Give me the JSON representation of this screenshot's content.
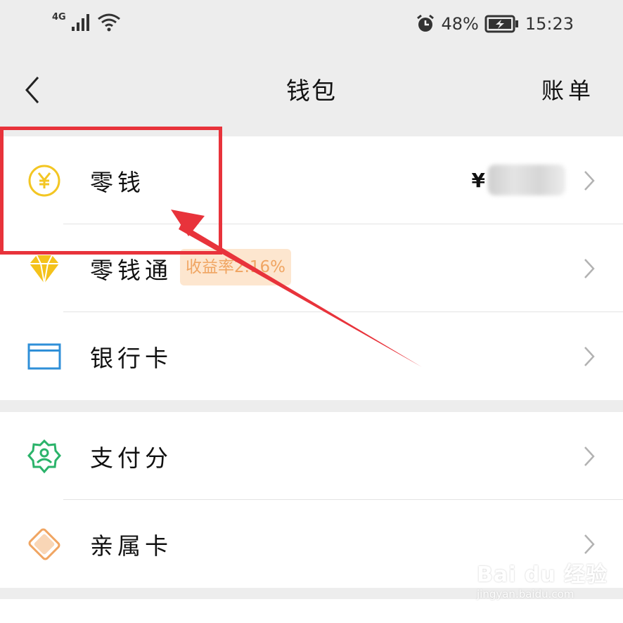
{
  "status": {
    "network": "4G",
    "battery": "48%",
    "time": "15:23"
  },
  "nav": {
    "title": "钱包",
    "right_action": "账单"
  },
  "groups": [
    {
      "rows": [
        {
          "label": "零钱",
          "icon": "yen-coin-icon",
          "value_prefix": "¥"
        },
        {
          "label": "零钱通",
          "icon": "diamond-icon",
          "badge": "收益率2.16%"
        },
        {
          "label": "银行卡",
          "icon": "bank-card-icon"
        }
      ]
    },
    {
      "rows": [
        {
          "label": "支付分",
          "icon": "pay-score-icon"
        },
        {
          "label": "亲属卡",
          "icon": "family-card-icon"
        }
      ]
    }
  ],
  "watermark": {
    "brand": "Bai du 经验",
    "url": "jingyan.baidu.com"
  },
  "colors": {
    "highlight": "#e8333b",
    "yen_icon": "#f3c623",
    "diamond_icon": "#f4c21b",
    "bank_card_icon": "#2f8fd8",
    "pay_score_icon": "#2bb36a",
    "family_card_icon": "#f0a562"
  }
}
